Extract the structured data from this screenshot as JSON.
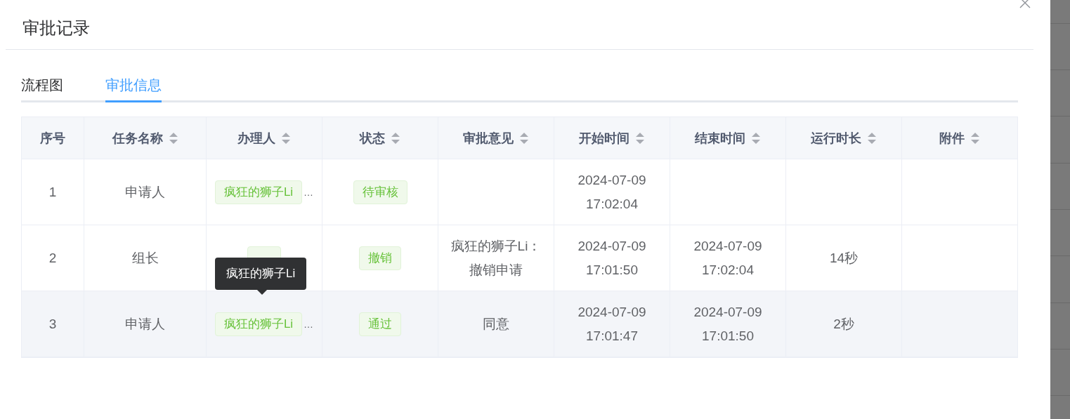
{
  "dialog": {
    "title": "审批记录"
  },
  "tabs": [
    {
      "label": "流程图",
      "selected": false
    },
    {
      "label": "审批信息",
      "selected": true
    }
  ],
  "table": {
    "columns": [
      {
        "label": "序号",
        "sortable": false
      },
      {
        "label": "任务名称",
        "sortable": true
      },
      {
        "label": "办理人",
        "sortable": true
      },
      {
        "label": "状态",
        "sortable": true
      },
      {
        "label": "审批意见",
        "sortable": true
      },
      {
        "label": "开始时间",
        "sortable": true
      },
      {
        "label": "结束时间",
        "sortable": true
      },
      {
        "label": "运行时长",
        "sortable": true
      },
      {
        "label": "附件",
        "sortable": true
      }
    ],
    "rows": [
      {
        "index": "1",
        "task": "申请人",
        "handler": "疯狂的狮子Li",
        "handler_more": "…",
        "status": "待审核",
        "start": [
          "2024-07-09",
          "17:02:04"
        ],
        "highlighted": false
      },
      {
        "index": "2",
        "task": "组长",
        "covered_tag": true,
        "status": "撤销",
        "comment": "疯狂的狮子Li：撤销申请",
        "start": [
          "2024-07-09",
          "17:01:50"
        ],
        "end": [
          "2024-07-09",
          "17:02:04"
        ],
        "duration": "14秒",
        "highlighted": false
      },
      {
        "index": "3",
        "task": "申请人",
        "handler": "疯狂的狮子Li",
        "handler_more": "…",
        "status": "通过",
        "comment": "同意",
        "start": [
          "2024-07-09",
          "17:01:47"
        ],
        "end": [
          "2024-07-09",
          "17:01:50"
        ],
        "duration": "2秒",
        "highlighted": true
      }
    ]
  },
  "tooltip": {
    "text": "疯狂的狮子Li"
  }
}
